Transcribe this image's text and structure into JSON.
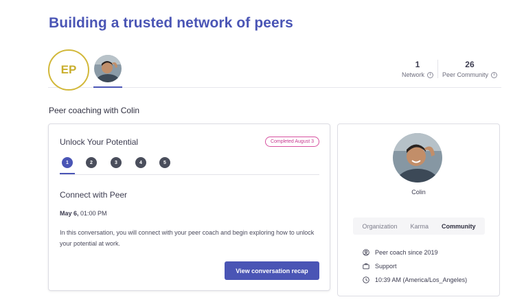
{
  "page": {
    "title": "Building a trusted network of peers"
  },
  "avatars": {
    "user_initials": "EP"
  },
  "stats": [
    {
      "value": "1",
      "label": "Network"
    },
    {
      "value": "26",
      "label": "Peer Community"
    }
  ],
  "section": {
    "title": "Peer coaching with Colin"
  },
  "session": {
    "title": "Unlock Your Potential",
    "badge": "Completed August 3",
    "steps": [
      "1",
      "2",
      "3",
      "4",
      "5"
    ],
    "active_step": 1,
    "step_title": "Connect with Peer",
    "date_bold": "May 6,",
    "time": "01:00 PM",
    "description": "In this conversation, you will connect with your peer coach and begin exploring how to unlock your potential at work.",
    "recap_button": "View conversation recap"
  },
  "peer": {
    "name": "Colin",
    "tabs": [
      {
        "label": "Organization",
        "active": false
      },
      {
        "label": "Karma",
        "active": false
      },
      {
        "label": "Community",
        "active": true
      }
    ],
    "details": [
      {
        "icon": "user-circle-icon",
        "text": "Peer coach since 2019"
      },
      {
        "icon": "briefcase-icon",
        "text": "Support"
      },
      {
        "icon": "clock-icon",
        "text": "10:39 AM (America/Los_Angeles)"
      }
    ]
  },
  "colors": {
    "accent": "#4a55b5",
    "badge": "#c6388f",
    "initials_ring": "#d2b83a"
  }
}
